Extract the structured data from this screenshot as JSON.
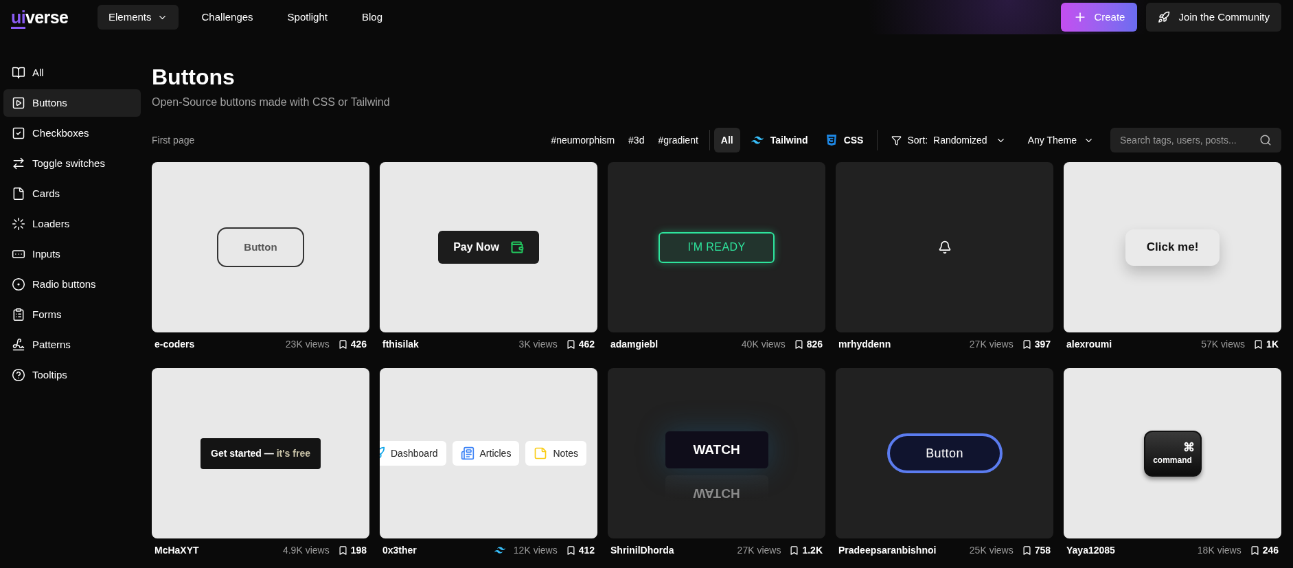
{
  "logo": {
    "prefix": "ui",
    "name": "verse"
  },
  "nav": [
    {
      "label": "Elements",
      "selected": true,
      "dropdown": true
    },
    {
      "label": "Challenges",
      "selected": false,
      "dropdown": false
    },
    {
      "label": "Spotlight",
      "selected": false,
      "dropdown": false
    },
    {
      "label": "Blog",
      "selected": false,
      "dropdown": false
    }
  ],
  "header_buttons": [
    {
      "label": "Create",
      "kind": "primary"
    },
    {
      "label": "Join the Community",
      "kind": "secondary"
    }
  ],
  "sidebar": {
    "items": [
      {
        "label": "All",
        "selected": false
      },
      {
        "label": "Buttons",
        "selected": true
      },
      {
        "label": "Checkboxes",
        "selected": false
      },
      {
        "label": "Toggle switches",
        "selected": false
      },
      {
        "label": "Cards",
        "selected": false
      },
      {
        "label": "Loaders",
        "selected": false
      },
      {
        "label": "Inputs",
        "selected": false
      },
      {
        "label": "Radio buttons",
        "selected": false
      },
      {
        "label": "Forms",
        "selected": false
      },
      {
        "label": "Patterns",
        "selected": false
      },
      {
        "label": "Tooltips",
        "selected": false
      }
    ]
  },
  "page": {
    "title": "Buttons",
    "subtitle": "Open-Source buttons made with CSS or Tailwind"
  },
  "toolbar": {
    "pager": "First page",
    "tags": [
      "#neumorphism",
      "#3d",
      "#gradient"
    ],
    "frameworks": [
      {
        "label": "All",
        "kind": "all",
        "selected": true
      },
      {
        "label": "Tailwind",
        "kind": "tailwind",
        "selected": false
      },
      {
        "label": "CSS",
        "kind": "css",
        "selected": false
      }
    ],
    "sort": {
      "label": "Sort:",
      "value": "Randomized"
    },
    "theme": "Any Theme",
    "search": {
      "placeholder": "Search tags, users, posts..."
    }
  },
  "cards": [
    {
      "author": "e-coders",
      "views": "23K views",
      "saves": "426",
      "dark": false,
      "tailwind": false,
      "preview": {
        "kind": "outline",
        "text": "Button"
      }
    },
    {
      "author": "fthisilak",
      "views": "3K views",
      "saves": "462",
      "dark": false,
      "tailwind": false,
      "preview": {
        "kind": "pay",
        "text": "Pay Now"
      }
    },
    {
      "author": "adamgiebl",
      "views": "40K views",
      "saves": "826",
      "dark": true,
      "tailwind": false,
      "preview": {
        "kind": "glow",
        "text": "I'M READY"
      }
    },
    {
      "author": "mrhyddenn",
      "views": "27K views",
      "saves": "397",
      "dark": true,
      "tailwind": false,
      "preview": {
        "kind": "bell"
      }
    },
    {
      "author": "alexroumi",
      "views": "57K views",
      "saves": "1K",
      "dark": false,
      "tailwind": false,
      "preview": {
        "kind": "raised",
        "text": "Click me!"
      }
    },
    {
      "author": "McHaXYT",
      "views": "4.9K views",
      "saves": "198",
      "dark": false,
      "tailwind": false,
      "preview": {
        "kind": "split",
        "text": "Get started —",
        "secondary": "it's free"
      }
    },
    {
      "author": "0x3ther",
      "views": "12K views",
      "saves": "412",
      "dark": false,
      "tailwind": true,
      "preview": {
        "kind": "tabs",
        "items": [
          "Dashboard",
          "Articles",
          "Notes"
        ]
      }
    },
    {
      "author": "ShrinilDhorda",
      "views": "27K views",
      "saves": "1.2K",
      "dark": true,
      "tailwind": false,
      "preview": {
        "kind": "reflect",
        "text": "WATCH",
        "reflection": "WATCH"
      }
    },
    {
      "author": "Pradeepsaranbishnoi",
      "views": "25K views",
      "saves": "758",
      "dark": true,
      "tailwind": false,
      "preview": {
        "kind": "pill",
        "text": "Button"
      }
    },
    {
      "author": "Yaya12085",
      "views": "18K views",
      "saves": "246",
      "dark": false,
      "tailwind": false,
      "preview": {
        "kind": "key",
        "symbol": "⌘",
        "text": "command"
      }
    }
  ]
}
